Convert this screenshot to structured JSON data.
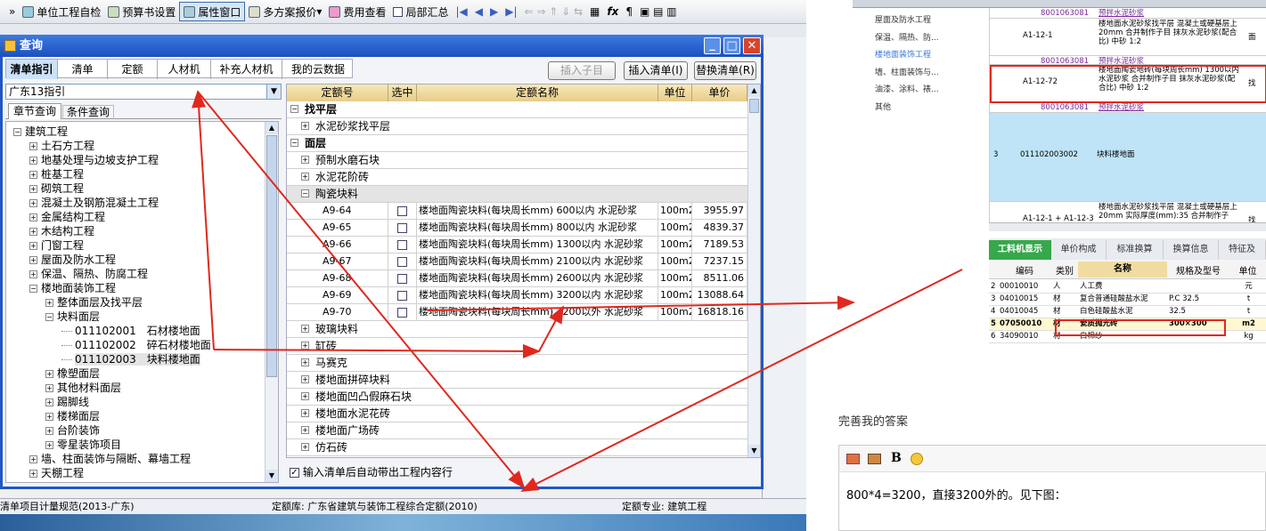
{
  "toolbar": {
    "items": [
      "»",
      "单位工程自检",
      "预算书设置",
      "属性窗口",
      "多方案报价",
      "费用查看",
      "局部汇总"
    ],
    "chevron": "»"
  },
  "dialog": {
    "title": "查询",
    "tabs": [
      "清单指引",
      "清单",
      "定额",
      "人材机",
      "补充人材机",
      "我的云数据"
    ],
    "insert_child": "插入子目",
    "insert_list": "插入清单(I)",
    "replace_list": "替换清单(R)",
    "select_value": "广东13指引",
    "subtabs": [
      "章节查询",
      "条件查询"
    ],
    "tree": [
      {
        "label": "建筑工程",
        "level": 0,
        "sign": "−"
      },
      {
        "label": "土石方工程",
        "level": 1,
        "sign": "+"
      },
      {
        "label": "地基处理与边坡支护工程",
        "level": 1,
        "sign": "+"
      },
      {
        "label": "桩基工程",
        "level": 1,
        "sign": "+"
      },
      {
        "label": "砌筑工程",
        "level": 1,
        "sign": "+"
      },
      {
        "label": "混凝土及钢筋混凝土工程",
        "level": 1,
        "sign": "+"
      },
      {
        "label": "金属结构工程",
        "level": 1,
        "sign": "+"
      },
      {
        "label": "木结构工程",
        "level": 1,
        "sign": "+"
      },
      {
        "label": "门窗工程",
        "level": 1,
        "sign": "+"
      },
      {
        "label": "屋面及防水工程",
        "level": 1,
        "sign": "+"
      },
      {
        "label": "保温、隔热、防腐工程",
        "level": 1,
        "sign": "+"
      },
      {
        "label": "楼地面装饰工程",
        "level": 1,
        "sign": "−"
      },
      {
        "label": "整体面层及找平层",
        "level": 2,
        "sign": "+"
      },
      {
        "label": "块料面层",
        "level": 2,
        "sign": "−"
      },
      {
        "label": "011102001　石材楼地面",
        "level": 3,
        "sign": ""
      },
      {
        "label": "011102002　碎石材楼地面",
        "level": 3,
        "sign": ""
      },
      {
        "label": "011102003　块料楼地面",
        "level": 3,
        "sign": "",
        "selected": true
      },
      {
        "label": "橡塑面层",
        "level": 2,
        "sign": "+"
      },
      {
        "label": "其他材料面层",
        "level": 2,
        "sign": "+"
      },
      {
        "label": "踢脚线",
        "level": 2,
        "sign": "+"
      },
      {
        "label": "楼梯面层",
        "level": 2,
        "sign": "+"
      },
      {
        "label": "台阶装饰",
        "level": 2,
        "sign": "+"
      },
      {
        "label": "零星装饰项目",
        "level": 2,
        "sign": "+"
      },
      {
        "label": "墙、柱面装饰与隔断、幕墙工程",
        "level": 1,
        "sign": "+"
      },
      {
        "label": "天棚工程",
        "level": 1,
        "sign": "+"
      }
    ],
    "grid_headers": [
      "定额号",
      "选中",
      "定额名称",
      "单位",
      "单价"
    ],
    "grid_rows": [
      {
        "type": "group",
        "sign": "−",
        "label": "找平层"
      },
      {
        "type": "sub",
        "sign": "+",
        "label": "水泥砂浆找平层"
      },
      {
        "type": "group",
        "sign": "−",
        "label": "面层"
      },
      {
        "type": "sub",
        "sign": "+",
        "label": "预制水磨石块"
      },
      {
        "type": "sub",
        "sign": "+",
        "label": "水泥花阶砖"
      },
      {
        "type": "sub",
        "sign": "−",
        "label": "陶瓷块料",
        "highlight": true
      },
      {
        "type": "item",
        "code": "A9-64",
        "name": "楼地面陶瓷块料(每块周长mm) 600以内 水泥砂浆",
        "unit": "100m2",
        "price": "3955.97"
      },
      {
        "type": "item",
        "code": "A9-65",
        "name": "楼地面陶瓷块料(每块周长mm) 800以内 水泥砂浆",
        "unit": "100m2",
        "price": "4839.37"
      },
      {
        "type": "item",
        "code": "A9-66",
        "name": "楼地面陶瓷块料(每块周长mm) 1300以内 水泥砂浆",
        "unit": "100m2",
        "price": "7189.53"
      },
      {
        "type": "item",
        "code": "A9-67",
        "name": "楼地面陶瓷块料(每块周长mm) 2100以内 水泥砂浆",
        "unit": "100m2",
        "price": "7237.15"
      },
      {
        "type": "item",
        "code": "A9-68",
        "name": "楼地面陶瓷块料(每块周长mm) 2600以内 水泥砂浆",
        "unit": "100m2",
        "price": "8511.06"
      },
      {
        "type": "item",
        "code": "A9-69",
        "name": "楼地面陶瓷块料(每块周长mm) 3200以内 水泥砂浆",
        "unit": "100m2",
        "price": "13088.64"
      },
      {
        "type": "item",
        "code": "A9-70",
        "name": "楼地面陶瓷块料(每块周长mm) 3200以外 水泥砂浆",
        "unit": "100m2",
        "price": "16818.16"
      },
      {
        "type": "sub",
        "sign": "+",
        "label": "玻璃块料"
      },
      {
        "type": "sub",
        "sign": "+",
        "label": "缸砖"
      },
      {
        "type": "sub",
        "sign": "+",
        "label": "马赛克"
      },
      {
        "type": "sub",
        "sign": "+",
        "label": "楼地面拼碎块料"
      },
      {
        "type": "sub",
        "sign": "+",
        "label": "楼地面凹凸假麻石块"
      },
      {
        "type": "sub",
        "sign": "+",
        "label": "楼地面水泥花砖"
      },
      {
        "type": "sub",
        "sign": "+",
        "label": "楼地面广场砖"
      },
      {
        "type": "sub",
        "sign": "+",
        "label": "仿石砖"
      }
    ],
    "auto_bring": "输入清单后自动带出工程内容行"
  },
  "status": {
    "left": "清单项目计量规范(2013-广东)",
    "mid": "定额库: 广东省建筑与装饰工程综合定额(2010)",
    "right": "定额专业: 建筑工程"
  },
  "right_top": {
    "tree": [
      "屋面及防水工程",
      "保温、隔热、防...",
      "楼地面装饰工程",
      "墙、柱面装饰与...",
      "油漆、涂料、裱...",
      "其他"
    ],
    "rows": [
      {
        "code": "8001063081",
        "desc": "预拌水泥砂浆"
      },
      {
        "code": "A1-12-1",
        "desc": "楼地面水泥砂浆找平层 混凝土或硬基层上 20mm 合并制作子目 抹灰水泥砂浆(配合比) 中砂 1:2",
        "extra": "面"
      },
      {
        "code": "8001063081",
        "desc": "预拌水泥砂浆"
      },
      {
        "code": "A1-12-72",
        "desc": "楼地面陶瓷地砖(每块周长mm) 1300以内 水泥砂浆 合并制作子目 抹灰水泥砂浆(配合比) 中砂 1:2",
        "extra": "找"
      },
      {
        "code": "8001063081",
        "desc": "预拌水泥砂浆"
      },
      {
        "num": "3",
        "code": "011102003002",
        "desc": "块料楼地面"
      },
      {
        "code": "A1-12-1 + A1-12-3 * 3",
        "desc": "楼地面水泥砂浆找平层 混凝土或硬基层上 20mm 实际厚度(mm):35 合并制作子",
        "extra": "找"
      }
    ]
  },
  "right_bottom": {
    "tabs": [
      "工料机显示",
      "单价构成",
      "标准换算",
      "换算信息",
      "特征及"
    ],
    "headers": [
      "编码",
      "类别",
      "名称",
      "规格及型号",
      "单位"
    ],
    "rows": [
      [
        "2",
        "00010010",
        "人",
        "人工费",
        "",
        "元"
      ],
      [
        "3",
        "04010015",
        "材",
        "复合普通硅酸盐水泥",
        "P.C 32.5",
        "t"
      ],
      [
        "4",
        "04010045",
        "材",
        "白色硅酸盐水泥",
        "32.5",
        "t"
      ],
      [
        "5",
        "07050010",
        "材",
        "瓷质抛光砖",
        "300×300",
        "m2"
      ],
      [
        "6",
        "34090010",
        "材",
        "白棉纱",
        "",
        "kg"
      ]
    ]
  },
  "answer": {
    "title": "完善我的答案",
    "bold": "B",
    "text": "800*4=3200，直接3200外的。见下图："
  },
  "colors": {
    "accent": "#0a4fa5",
    "annotation": "#e0281e",
    "grid_header": "#f0dca0",
    "titlebar": "#1f57c6"
  }
}
